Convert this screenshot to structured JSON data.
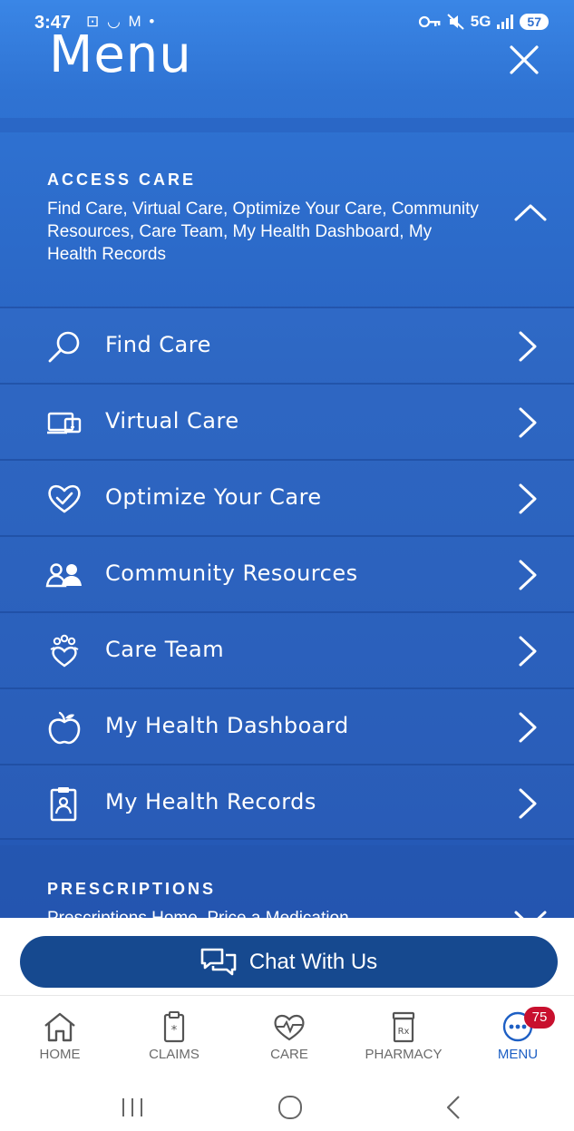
{
  "status_bar": {
    "time": "3:47",
    "left_icons": "⊡ ◡ M •",
    "network": "5G",
    "battery": "57"
  },
  "header": {
    "title": "Menu",
    "close_icon": "close-icon"
  },
  "access_care": {
    "title": "ACCESS CARE",
    "subtitle": "Find Care, Virtual Care, Optimize Your Care, Community Resources, Care Team, My Health Dashboard, My Health Records",
    "expanded": true,
    "items": [
      {
        "label": "Find Care",
        "icon": "search-icon"
      },
      {
        "label": "Virtual Care",
        "icon": "virtual-care-icon"
      },
      {
        "label": "Optimize Your Care",
        "icon": "heart-check-icon"
      },
      {
        "label": "Community Resources",
        "icon": "people-icon"
      },
      {
        "label": "Care Team",
        "icon": "care-team-icon"
      },
      {
        "label": "My Health Dashboard",
        "icon": "apple-icon"
      },
      {
        "label": "My Health Records",
        "icon": "clipboard-icon"
      }
    ]
  },
  "prescriptions": {
    "title": "PRESCRIPTIONS",
    "subtitle": "Prescriptions Home, Price a Medication"
  },
  "chat": {
    "label": "Chat With Us"
  },
  "bottom_nav": {
    "items": [
      {
        "label": "HOME",
        "icon": "home-icon"
      },
      {
        "label": "CLAIMS",
        "icon": "claims-icon"
      },
      {
        "label": "CARE",
        "icon": "care-heart-icon"
      },
      {
        "label": "PHARMACY",
        "icon": "pharmacy-icon"
      },
      {
        "label": "MENU",
        "icon": "menu-dots-icon",
        "active": true,
        "badge": "75"
      }
    ]
  },
  "colors": {
    "menu_background": "#2a64c2",
    "chat_button": "#16498f",
    "active_nav": "#1d5fc4",
    "badge": "#c8102e"
  }
}
